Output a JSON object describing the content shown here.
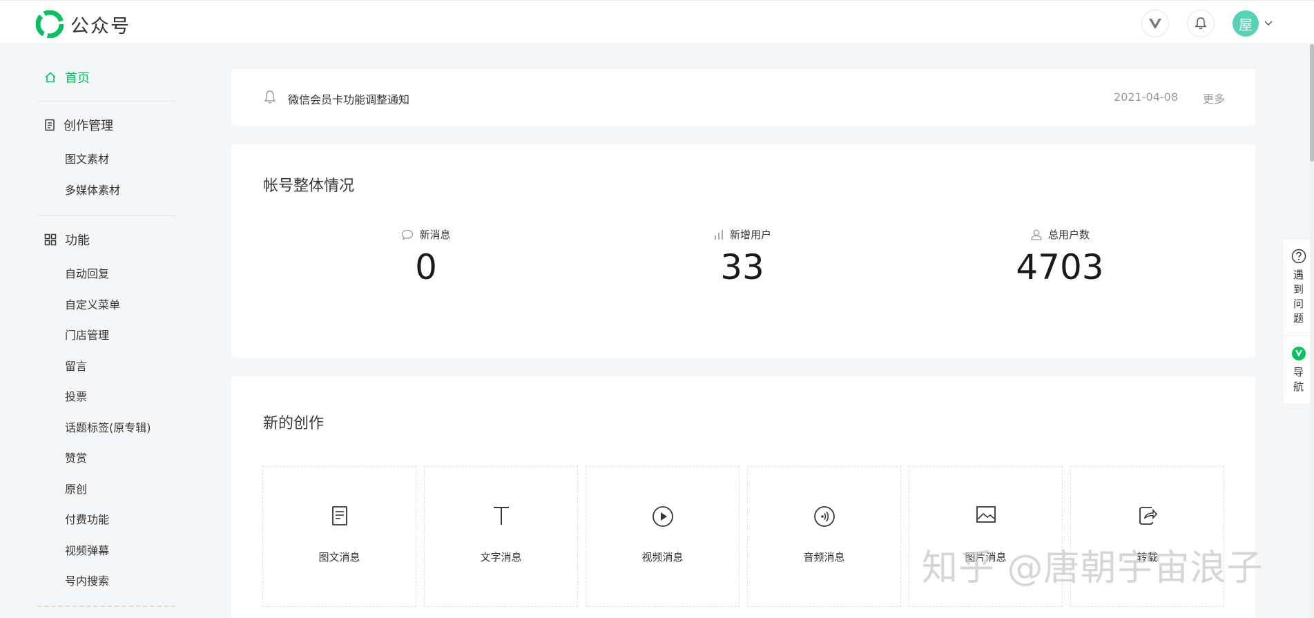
{
  "header": {
    "app_name": "公众号",
    "avatar_text": "屋",
    "brand_color": "#07c160"
  },
  "sidebar": {
    "home": "首页",
    "groups": [
      {
        "label": "创作管理",
        "items": [
          "图文素材",
          "多媒体素材"
        ]
      },
      {
        "label": "功能",
        "items": [
          "自动回复",
          "自定义菜单",
          "门店管理",
          "留言",
          "投票",
          "话题标签(原专辑)",
          "赞赏",
          "原创",
          "付费功能",
          "视频弹幕",
          "号内搜索"
        ]
      }
    ]
  },
  "notice": {
    "text": "微信会员卡功能调整通知",
    "date": "2021-04-08",
    "more": "更多"
  },
  "overview": {
    "title": "帐号整体情况",
    "stats": [
      {
        "label": "新消息",
        "value": "0",
        "icon": "message-icon"
      },
      {
        "label": "新增用户",
        "value": "33",
        "icon": "bar-chart-icon"
      },
      {
        "label": "总用户数",
        "value": "4703",
        "icon": "user-icon"
      }
    ]
  },
  "create": {
    "title": "新的创作",
    "items": [
      {
        "label": "图文消息",
        "icon": "article-icon"
      },
      {
        "label": "文字消息",
        "icon": "text-icon"
      },
      {
        "label": "视频消息",
        "icon": "video-icon"
      },
      {
        "label": "音频消息",
        "icon": "audio-icon"
      },
      {
        "label": "图片消息",
        "icon": "image-icon"
      },
      {
        "label": "转载",
        "icon": "share-icon"
      }
    ]
  },
  "float_help": {
    "problem": "遇到问题",
    "guide": "导航"
  },
  "watermark": "知乎 @唐朝宇宙浪子"
}
